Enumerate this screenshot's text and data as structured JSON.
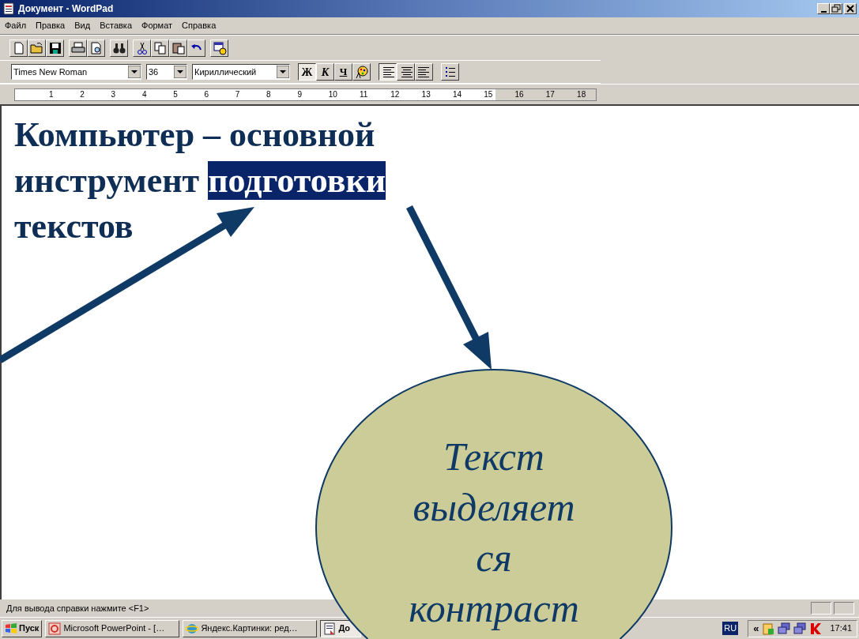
{
  "window": {
    "title": "Документ - WordPad"
  },
  "menu": [
    "Файл",
    "Правка",
    "Вид",
    "Вставка",
    "Формат",
    "Справка"
  ],
  "format_bar": {
    "font": "Times New Roman",
    "size": "36",
    "script": "Кириллический",
    "style_buttons": [
      {
        "label": "Ж",
        "selected": true
      },
      {
        "label": "К",
        "selected": false
      },
      {
        "label": "Ч",
        "selected": false
      }
    ],
    "align_buttons": [
      {
        "kind": "left",
        "selected": true
      },
      {
        "kind": "center",
        "selected": false
      },
      {
        "kind": "right",
        "selected": false
      }
    ]
  },
  "ruler": [
    "1",
    "2",
    "3",
    "4",
    "5",
    "6",
    "7",
    "8",
    "9",
    "10",
    "11",
    "12",
    "13",
    "14",
    "15",
    "16",
    "17",
    "18"
  ],
  "document": {
    "lines": [
      [
        {
          "text": "Компьютер – основной",
          "selected": false
        }
      ],
      [
        {
          "text": "инструмент ",
          "selected": false
        },
        {
          "text": "подготовки",
          "selected": true
        }
      ],
      [
        {
          "text": "текстов",
          "selected": false
        }
      ]
    ]
  },
  "status_bar": {
    "text": "Для вывода справки нажмите <F1>"
  },
  "taskbar": {
    "start": "Пуск",
    "tasks": [
      {
        "kind": "presentation",
        "label": "Microsoft PowerPoint - […",
        "selected": false
      },
      {
        "kind": "browser",
        "label": "Яндекс.Картинки: ред…",
        "selected": false
      },
      {
        "kind": "document",
        "label": "До",
        "selected": true
      }
    ],
    "language": "RU",
    "tray_expand": "«",
    "clock": "17:41"
  },
  "callout": {
    "lines": [
      "Текст",
      "выделяет",
      "ся",
      "контраст"
    ]
  }
}
